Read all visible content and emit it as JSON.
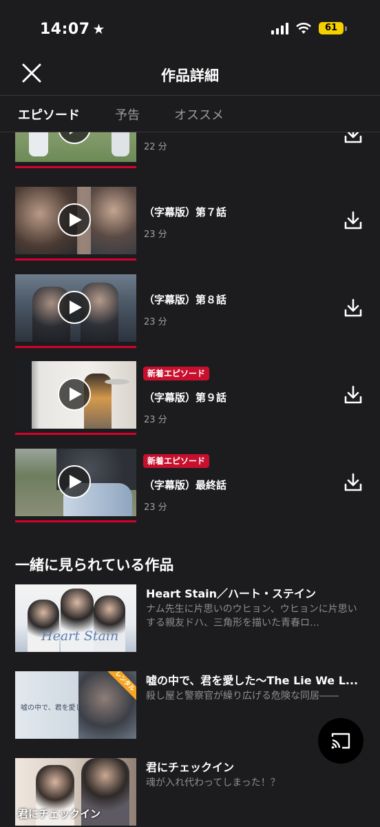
{
  "status_bar": {
    "time": "14:07",
    "battery": "61"
  },
  "header": {
    "title": "作品詳細"
  },
  "tabs": [
    {
      "label": "エピソード",
      "active": true
    },
    {
      "label": "予告",
      "active": false
    },
    {
      "label": "オススメ",
      "active": false
    }
  ],
  "episodes": [
    {
      "title": "",
      "duration": "22 分",
      "badge": ""
    },
    {
      "title": "（字幕版）第７話",
      "duration": "23 分",
      "badge": ""
    },
    {
      "title": "（字幕版）第８話",
      "duration": "23 分",
      "badge": ""
    },
    {
      "title": "（字幕版）第９話",
      "duration": "23 分",
      "badge": "新着エピソード"
    },
    {
      "title": "（字幕版）最終話",
      "duration": "23 分",
      "badge": "新着エピソード"
    }
  ],
  "recommendations": {
    "section_title": "一緒に見られている作品",
    "items": [
      {
        "title": "Heart Stain／ハート・ステイン",
        "description": "ナム先生に片思いのウヒョン、ウヒョンに片思いする親友ドハ、三角形を描いた青春ロ…",
        "thumb_text": "Heart Stain"
      },
      {
        "title": "嘘の中で、君を愛した～The Lie We L...",
        "description": "殺し屋と警察官が繰り広げる危険な同居――",
        "thumb_text": "嘘の中で、君を愛した",
        "badge": "レンタル"
      },
      {
        "title": "君にチェックイン",
        "description": "魂が入れ代わってしまった！？",
        "thumb_text": "君にチェックイン"
      }
    ]
  },
  "colors": {
    "background": "#1c1c1e",
    "accent": "#d7002d",
    "badge": "#c8102e",
    "rental": "#f5a623"
  }
}
